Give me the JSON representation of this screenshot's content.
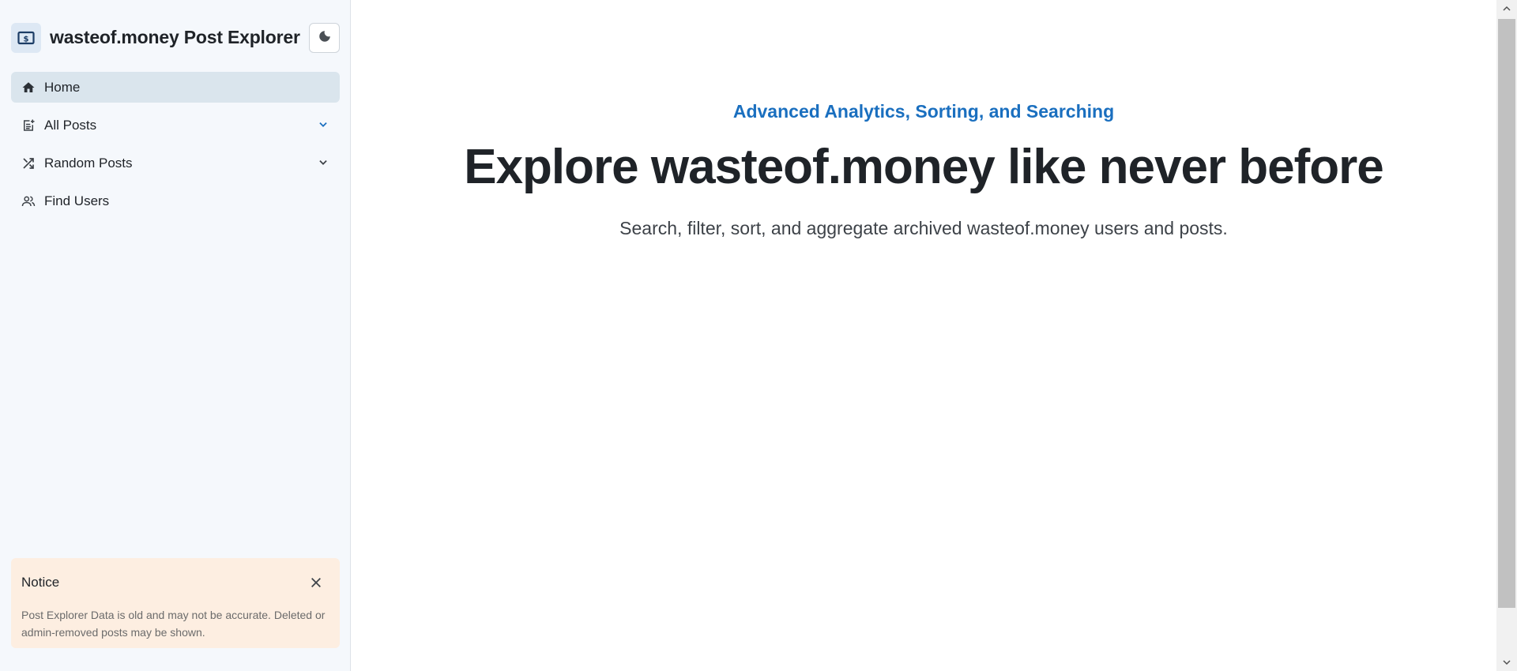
{
  "app": {
    "title": "wasteof.money Post Explorer"
  },
  "sidebar": {
    "items": [
      {
        "label": "Home",
        "icon": "home-icon",
        "active": true
      },
      {
        "label": "All Posts",
        "icon": "post-add-icon",
        "expandable": true
      },
      {
        "label": "Random Posts",
        "icon": "shuffle-icon",
        "expandable": true
      },
      {
        "label": "Find Users",
        "icon": "users-icon"
      }
    ],
    "notice": {
      "title": "Notice",
      "text": "Post Explorer Data is old and may not be accurate. Deleted or admin-removed posts may be shown."
    }
  },
  "main": {
    "eyebrow": "Advanced Analytics, Sorting, and Searching",
    "headline": "Explore wasteof.money like never before",
    "subtitle": "Search, filter, sort, and aggregate archived wasteof.money users and posts."
  },
  "colors": {
    "accent": "#1a6fbf",
    "sidebar_bg": "#f5f8fc",
    "active_bg": "#dae5ed",
    "notice_bg": "#fdeee1"
  }
}
